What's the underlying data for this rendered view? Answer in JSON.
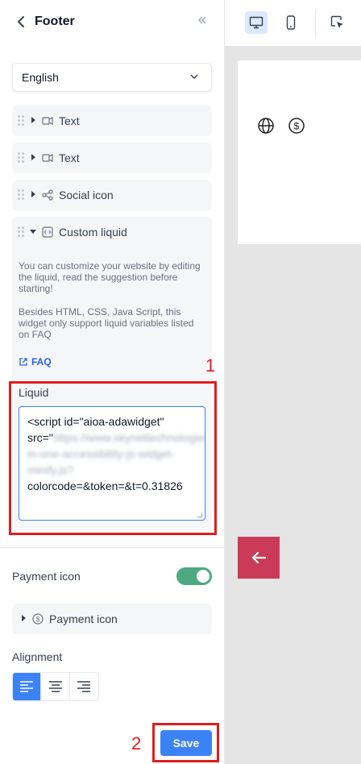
{
  "header": {
    "title": "Footer"
  },
  "language": {
    "selected": "English"
  },
  "blocks": [
    {
      "label": "Text",
      "icon": "text-icon"
    },
    {
      "label": "Text",
      "icon": "text-icon"
    },
    {
      "label": "Social icon",
      "icon": "share-icon"
    },
    {
      "label": "Custom liquid",
      "icon": "code-icon"
    }
  ],
  "custom_liquid": {
    "desc1": "You can customize your website by editing the liquid, read the suggestion before starting!",
    "desc2": "Besides HTML, CSS, Java Script, this widget only support liquid variables listed on FAQ",
    "faq": "FAQ",
    "liquid_label": "Liquid",
    "code_line1": "<script id=\"aioa-adawidget\"",
    "code_src": "src=\"",
    "code_blurred": "https://www.skynettechnologies.com/accessibility/js/all-in-one-accessibility-js-widget-minify.js?",
    "code_line_last": "colorcode=&token=&t=0.31826"
  },
  "payment": {
    "label": "Payment icon",
    "enabled": true,
    "block_label": "Payment icon"
  },
  "alignment": {
    "label": "Alignment",
    "options": [
      "left",
      "center",
      "right"
    ],
    "selected": "left"
  },
  "save_label": "Save",
  "annotations": {
    "n1": "1",
    "n2": "2",
    "color": "#e11d1d"
  },
  "colors": {
    "accent": "#3b82f6",
    "toggle": "#4ea983",
    "back_to_top": "#cc3a5a"
  }
}
